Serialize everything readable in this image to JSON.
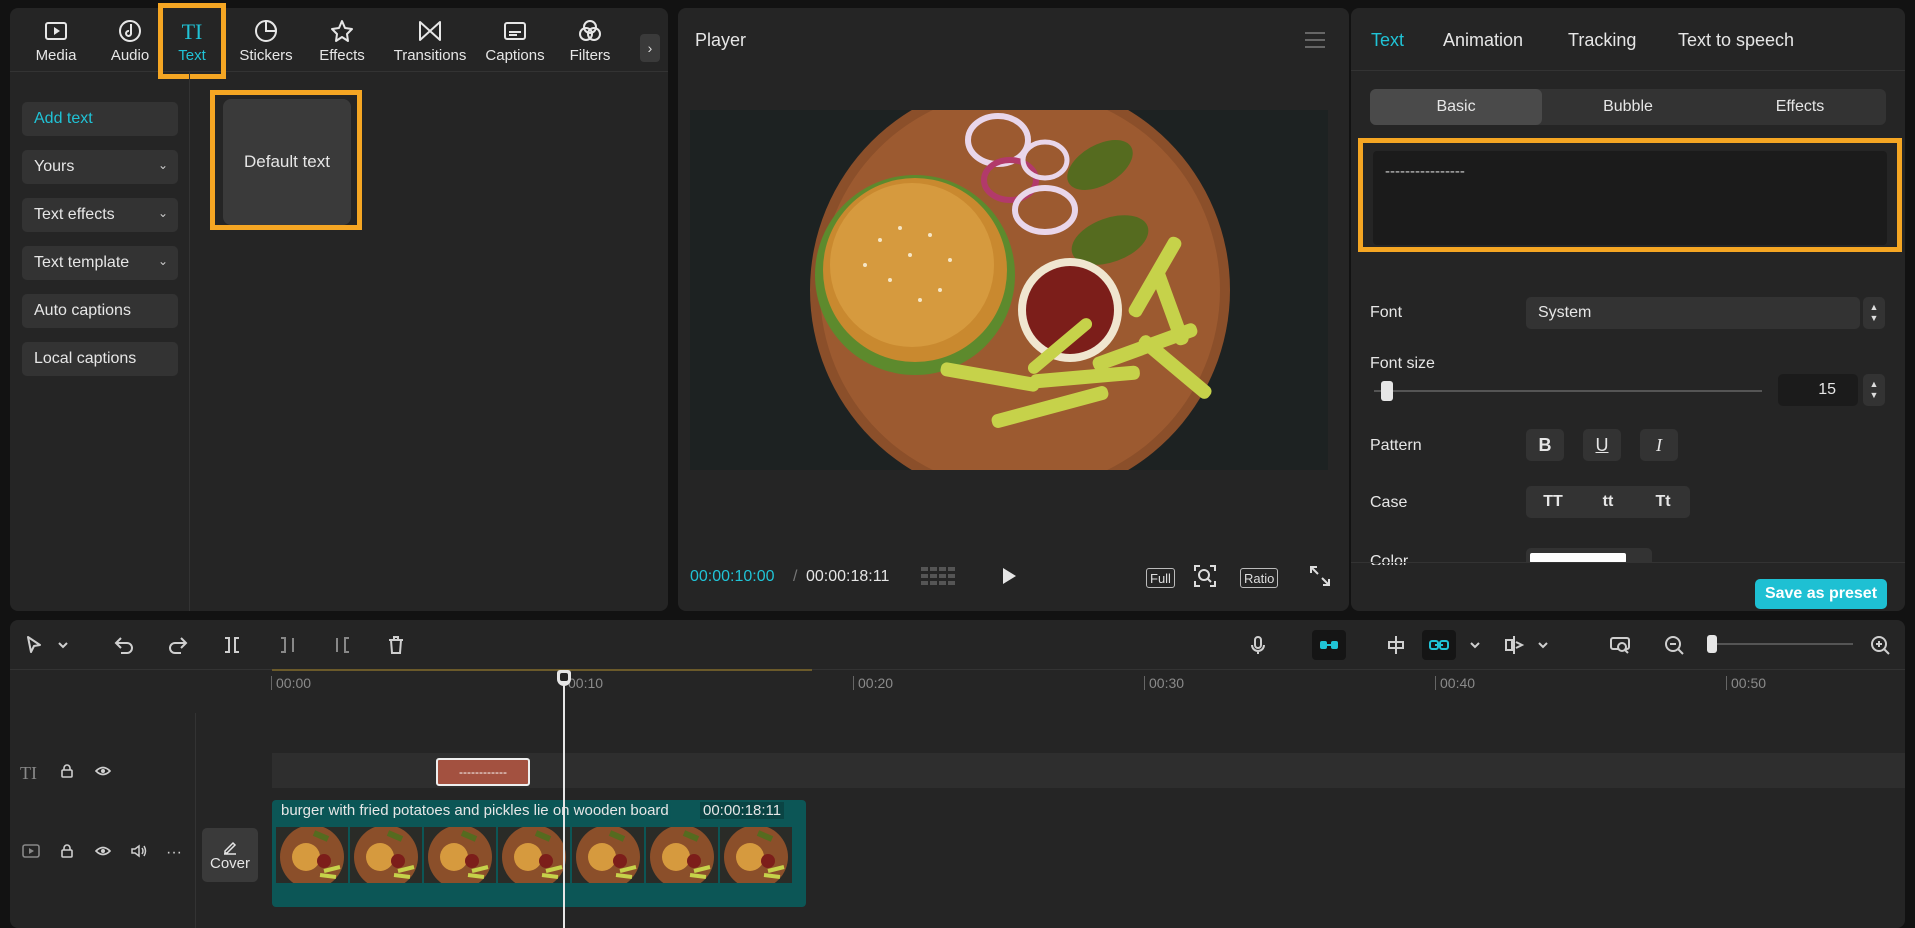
{
  "categories": [
    {
      "label": "Media",
      "icon": "media-icon"
    },
    {
      "label": "Audio",
      "icon": "audio-icon"
    },
    {
      "label": "Text",
      "icon": "text-icon",
      "active": true
    },
    {
      "label": "Stickers",
      "icon": "stickers-icon"
    },
    {
      "label": "Effects",
      "icon": "effects-icon"
    },
    {
      "label": "Transitions",
      "icon": "transitions-icon"
    },
    {
      "label": "Captions",
      "icon": "captions-icon"
    },
    {
      "label": "Filters",
      "icon": "filters-icon"
    }
  ],
  "text_menu": {
    "add_text": "Add text",
    "yours": "Yours",
    "text_effects": "Text effects",
    "text_template": "Text template",
    "auto_captions": "Auto captions",
    "local_captions": "Local captions",
    "default_text": "Default text"
  },
  "player": {
    "title": "Player",
    "current_time": "00:00:10:00",
    "separator": "/",
    "total_time": "00:00:18:11",
    "full_label": "Full",
    "ratio_label": "Ratio"
  },
  "properties": {
    "tabs": [
      "Text",
      "Animation",
      "Tracking",
      "Text to speech"
    ],
    "segments": [
      "Basic",
      "Bubble",
      "Effects"
    ],
    "text_value": "----------------",
    "font_label": "Font",
    "font_value": "System",
    "font_size_label": "Font size",
    "font_size_value": "15",
    "font_size_fraction": 0.02,
    "pattern_label": "Pattern",
    "pattern_bold": "B",
    "pattern_underline": "U",
    "pattern_italic": "I",
    "case_label": "Case",
    "case_upper": "TT",
    "case_lower": "tt",
    "case_title": "Tt",
    "color_label": "Color",
    "save_preset": "Save as preset"
  },
  "timeline": {
    "ruler": [
      "00:00",
      "00:10",
      "00:20",
      "00:30",
      "00:40",
      "00:50"
    ],
    "text_clip_label": "------------",
    "video_clip_name": "burger with fried potatoes and pickles lie on wooden board",
    "video_clip_duration": "00:00:18:11",
    "cover_label": "Cover"
  },
  "colors": {
    "accent": "#20c3d6",
    "highlight": "#f5a623",
    "text_clip": "#a35140",
    "video_clip": "#0c5656"
  }
}
